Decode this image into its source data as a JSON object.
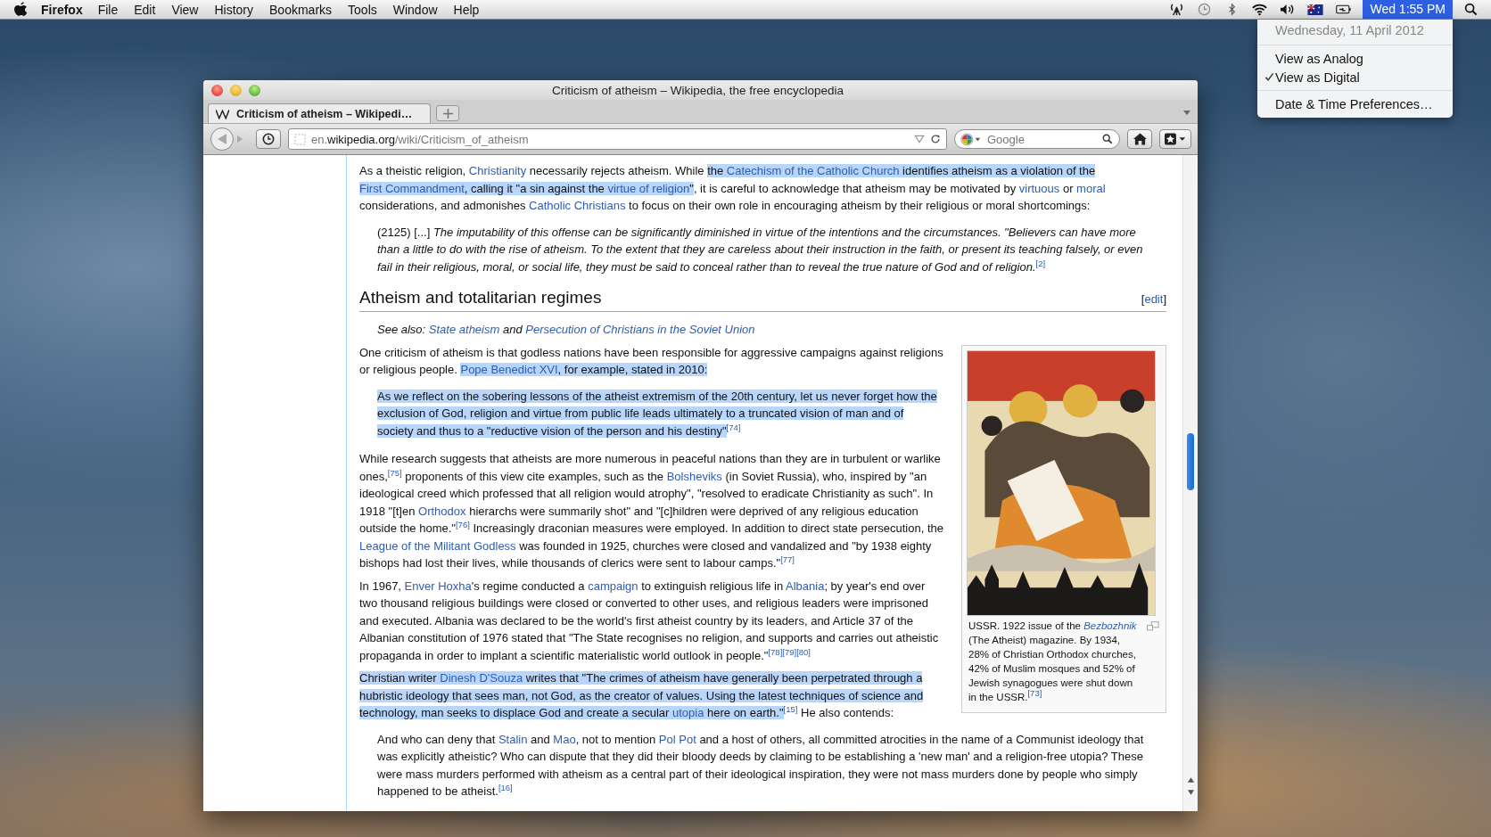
{
  "menubar": {
    "app": "Firefox",
    "menus": [
      "File",
      "Edit",
      "View",
      "History",
      "Bookmarks",
      "Tools",
      "Window",
      "Help"
    ],
    "clock": {
      "label": "Wed 1:55 PM",
      "selected": true
    }
  },
  "clock_menu": {
    "date": "Wednesday, 11 April 2012",
    "options": [
      {
        "label": "View as Analog",
        "checked": false
      },
      {
        "label": "View as Digital",
        "checked": true
      }
    ],
    "preferences": "Date & Time Preferences…"
  },
  "browser": {
    "title": "Criticism of atheism – Wikipedia, the free encyclopedia",
    "tabs": [
      {
        "label": "Criticism of atheism – Wikipedi…",
        "selected": true
      }
    ],
    "url": {
      "prefix": "en.",
      "domain": "wikipedia.org",
      "path": "/wiki/Criticism_of_atheism"
    },
    "search": {
      "placeholder": "Google"
    }
  },
  "article": {
    "blocks": [
      {
        "kind": "paragraph",
        "segments": [
          {
            "kind": "plain",
            "text": "As a theistic religion, ",
            "selected": false
          },
          {
            "kind": "link",
            "text": "Christianity",
            "selected": false
          },
          {
            "kind": "plain",
            "text": " necessarily rejects atheism. While ",
            "selected": false
          },
          {
            "kind": "plain",
            "text": "the ",
            "selected": true
          },
          {
            "kind": "link",
            "text": "Catechism of the Catholic Church",
            "selected": true
          },
          {
            "kind": "plain",
            "text": " identifies atheism as a violation of the ",
            "selected": true
          },
          {
            "kind": "link",
            "text": "First Commandment",
            "selected": true
          },
          {
            "kind": "plain",
            "text": ", calling it \"a sin against the ",
            "selected": true
          },
          {
            "kind": "link",
            "text": "virtue of religion",
            "selected": true
          },
          {
            "kind": "plain",
            "text": "\"",
            "selected": true
          },
          {
            "kind": "plain",
            "text": ", it is careful to acknowledge that atheism may be motivated by ",
            "selected": false
          },
          {
            "kind": "link",
            "text": "virtuous",
            "selected": false
          },
          {
            "kind": "plain",
            "text": " or ",
            "selected": false
          },
          {
            "kind": "link",
            "text": "moral",
            "selected": false
          },
          {
            "kind": "plain",
            "text": " considerations, and admonishes ",
            "selected": false
          },
          {
            "kind": "link",
            "text": "Catholic Christians",
            "selected": false
          },
          {
            "kind": "plain",
            "text": " to focus on their own role in encouraging atheism by their religious or moral shortcomings:",
            "selected": false
          }
        ]
      },
      {
        "kind": "quote",
        "segments": [
          {
            "kind": "plain",
            "text": "(2125) [...] ",
            "selected": false
          },
          {
            "kind": "italic",
            "text": "The imputability of this offense can be significantly diminished in virtue of the intentions and the circumstances. \"Believers can have more than a little to do with the rise of atheism. To the extent that they are careless about their instruction in the faith, or present its teaching falsely, or even fail in their religious, moral, or social life, they must be said to conceal rather than to reveal the true nature of God and of religion.",
            "selected": false
          },
          {
            "kind": "ref",
            "text": "[2]",
            "selected": false
          }
        ]
      },
      {
        "kind": "heading",
        "text": "Atheism and totalitarian regimes",
        "edit_open": "[",
        "edit": "edit",
        "edit_close": "]"
      },
      {
        "kind": "hatnote",
        "segments": [
          {
            "kind": "plain",
            "text": "See also: ",
            "selected": false
          },
          {
            "kind": "link",
            "text": "State atheism",
            "selected": false
          },
          {
            "kind": "plain",
            "text": " and ",
            "selected": false
          },
          {
            "kind": "link",
            "text": "Persecution of Christians in the Soviet Union",
            "selected": false
          }
        ]
      },
      {
        "kind": "paragraph",
        "segments": [
          {
            "kind": "plain",
            "text": "One criticism of atheism is that godless nations have been responsible for aggressive campaigns against religions or religious people. ",
            "selected": false
          },
          {
            "kind": "link",
            "text": "Pope Benedict XVI",
            "selected": true
          },
          {
            "kind": "plain",
            "text": ", for example, stated in 2010:",
            "selected": true
          }
        ]
      },
      {
        "kind": "quote",
        "segments": [
          {
            "kind": "plain",
            "text": "As we reflect on the sobering lessons of the atheist extremism of the 20th century, let us never forget how the ",
            "selected": true
          },
          {
            "kind": "plain",
            "text": "exclusion of God, religion and virtue from public life leads ultimately to a truncated vision of man and of ",
            "selected": true
          },
          {
            "kind": "plain",
            "text": "society and thus to a \"reductive vision of the person and his destiny\"",
            "selected": true
          },
          {
            "kind": "ref",
            "text": "[74]",
            "selected": false
          }
        ]
      },
      {
        "kind": "paragraph",
        "segments": [
          {
            "kind": "plain",
            "text": "While research suggests that atheists are more numerous in peaceful nations than they are in turbulent or warlike ones,",
            "selected": false
          },
          {
            "kind": "ref",
            "text": "[75]",
            "selected": false
          },
          {
            "kind": "plain",
            "text": " proponents of this view cite examples, such as the ",
            "selected": false
          },
          {
            "kind": "link",
            "text": "Bolsheviks",
            "selected": false
          },
          {
            "kind": "plain",
            "text": " (in Soviet Russia), who, inspired by \"an ideological creed which professed that all religion would atrophy\", \"resolved to eradicate Christianity as such\". In 1918 \"[t]en ",
            "selected": false
          },
          {
            "kind": "link",
            "text": "Orthodox",
            "selected": false
          },
          {
            "kind": "plain",
            "text": " hierarchs were summarily shot\" and \"[c]hildren were deprived of any religious education outside the home.\"",
            "selected": false
          },
          {
            "kind": "ref",
            "text": "[76]",
            "selected": false
          },
          {
            "kind": "plain",
            "text": " Increasingly draconian measures were employed. In addition to direct state persecution, the ",
            "selected": false
          },
          {
            "kind": "link",
            "text": "League of the Militant Godless",
            "selected": false
          },
          {
            "kind": "plain",
            "text": " was founded in 1925, churches were closed and vandalized and \"by 1938 eighty bishops had lost their lives, while thousands of clerics were sent to labour camps.\"",
            "selected": false
          },
          {
            "kind": "ref",
            "text": "[77]",
            "selected": false
          }
        ]
      },
      {
        "kind": "paragraph",
        "segments": [
          {
            "kind": "plain",
            "text": "In 1967, ",
            "selected": false
          },
          {
            "kind": "link",
            "text": "Enver Hoxha",
            "selected": false
          },
          {
            "kind": "plain",
            "text": "'s regime conducted a ",
            "selected": false
          },
          {
            "kind": "link",
            "text": "campaign",
            "selected": false
          },
          {
            "kind": "plain",
            "text": " to extinguish religious life in ",
            "selected": false
          },
          {
            "kind": "link",
            "text": "Albania",
            "selected": false
          },
          {
            "kind": "plain",
            "text": "; by year's end over two thousand religious buildings were closed or converted to other uses, and religious leaders were imprisoned and executed. Albania was declared to be the world's first atheist country by its leaders, and Article 37 of the Albanian constitution of 1976 stated that \"The State recognises no religion, and supports and carries out atheistic propaganda in order to implant a scientific materialistic world outlook in people.\"",
            "selected": false
          },
          {
            "kind": "ref",
            "text": "[78]",
            "selected": false
          },
          {
            "kind": "ref",
            "text": "[79]",
            "selected": false
          },
          {
            "kind": "ref",
            "text": "[80]",
            "selected": false
          }
        ]
      },
      {
        "kind": "paragraph",
        "segments": [
          {
            "kind": "plain",
            "text": "Christian writer ",
            "selected": true
          },
          {
            "kind": "link",
            "text": "Dinesh D'Souza",
            "selected": true
          },
          {
            "kind": "plain",
            "text": " writes that \"The crimes of atheism have generally been perpetrated through a ",
            "selected": true
          },
          {
            "kind": "plain",
            "text": "hubristic ideology that sees man, not God, as the creator of values. Using the latest techniques of science and ",
            "selected": true
          },
          {
            "kind": "plain",
            "text": "technology, man seeks to displace God and create a secular ",
            "selected": true
          },
          {
            "kind": "link",
            "text": "utopia",
            "selected": true
          },
          {
            "kind": "plain",
            "text": " here on earth.\"",
            "selected": true
          },
          {
            "kind": "ref",
            "text": "[15]",
            "selected": false
          },
          {
            "kind": "plain",
            "text": " He also contends:",
            "selected": false
          }
        ]
      },
      {
        "kind": "figure",
        "segments": [
          {
            "kind": "plain",
            "text": "USSR. 1922 issue of the ",
            "selected": false
          },
          {
            "kind": "italic_link",
            "text": "Bezbozhnik",
            "selected": false
          },
          {
            "kind": "plain",
            "text": " (The Atheist) magazine. By 1934, 28% of Christian Orthodox churches, 42% of Muslim mosques and 52% of Jewish synagogues were shut down in the USSR.",
            "selected": false
          },
          {
            "kind": "ref",
            "text": "[73]",
            "selected": false
          }
        ]
      },
      {
        "kind": "quote",
        "segments": [
          {
            "kind": "plain",
            "text": "And who can deny that ",
            "selected": false
          },
          {
            "kind": "link",
            "text": "Stalin",
            "selected": false
          },
          {
            "kind": "plain",
            "text": " and ",
            "selected": false
          },
          {
            "kind": "link",
            "text": "Mao",
            "selected": false
          },
          {
            "kind": "plain",
            "text": ", not to mention ",
            "selected": false
          },
          {
            "kind": "link",
            "text": "Pol Pot",
            "selected": false
          },
          {
            "kind": "plain",
            "text": " and a host of others, all committed atrocities in the name of a Communist ideology that was explicitly atheistic? Who can dispute that they did their bloody deeds by claiming to be establishing a 'new man' and a religion-free utopia? These were mass murders performed with atheism as a central part of their ideological inspiration, they were not mass murders done by people who simply happened to be atheist.",
            "selected": false
          },
          {
            "kind": "ref",
            "text": "[16]",
            "selected": false
          }
        ]
      }
    ]
  }
}
